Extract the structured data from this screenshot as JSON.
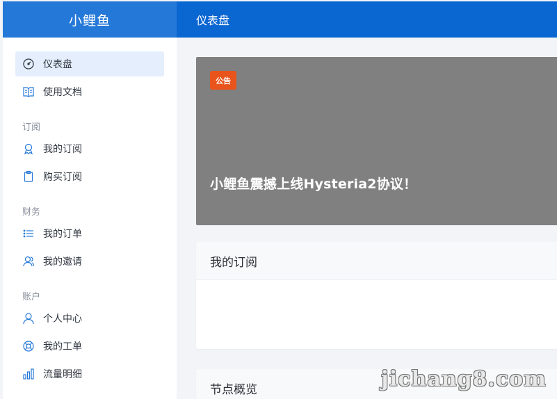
{
  "header": {
    "brand": "小鲤鱼",
    "title": "仪表盘"
  },
  "sidebar": {
    "items_top": [
      {
        "label": "仪表盘",
        "icon": "gauge-icon",
        "active": true
      },
      {
        "label": "使用文档",
        "icon": "book-icon"
      }
    ],
    "sections": [
      {
        "label": "订阅",
        "items": [
          {
            "label": "我的订阅",
            "icon": "award-icon"
          },
          {
            "label": "购买订阅",
            "icon": "clipboard-icon"
          }
        ]
      },
      {
        "label": "财务",
        "items": [
          {
            "label": "我的订单",
            "icon": "list-icon"
          },
          {
            "label": "我的邀请",
            "icon": "users-icon"
          }
        ]
      },
      {
        "label": "账户",
        "items": [
          {
            "label": "个人中心",
            "icon": "user-icon"
          },
          {
            "label": "我的工单",
            "icon": "lifebuoy-icon"
          },
          {
            "label": "流量明细",
            "icon": "bar-chart-icon"
          }
        ]
      }
    ]
  },
  "main": {
    "notice": {
      "badge": "公告",
      "title": "小鲤鱼震撼上线Hysteria2协议！"
    },
    "subscription_card": {
      "title": "我的订阅"
    },
    "nodes_card": {
      "title": "节点概览"
    }
  },
  "watermark": "jichang8.com",
  "colors": {
    "header": "#0a66d1",
    "brand_bg": "#2478d8",
    "active_bg": "#e4eefc",
    "badge": "#e8541c",
    "notice_bg": "#808080",
    "icon": "#2478d8"
  }
}
